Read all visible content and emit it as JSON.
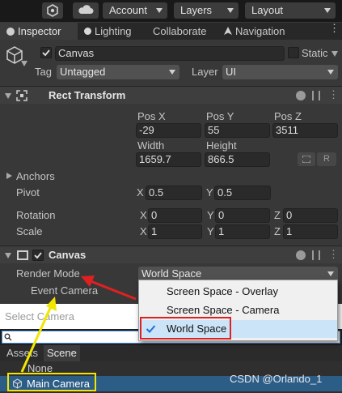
{
  "toolbar": {
    "account_label": "Account",
    "layers_label": "Layers",
    "layout_label": "Layout"
  },
  "tabs": {
    "inspector": "Inspector",
    "lighting": "Lighting",
    "collaborate": "Collaborate",
    "navigation": "Navigation"
  },
  "object": {
    "name": "Canvas",
    "static_label": "Static",
    "tag_label": "Tag",
    "tag_value": "Untagged",
    "layer_label": "Layer",
    "layer_value": "UI"
  },
  "rect_transform": {
    "title": "Rect Transform",
    "pos_x_label": "Pos X",
    "pos_y_label": "Pos Y",
    "pos_z_label": "Pos Z",
    "pos_x": "-29",
    "pos_y": "55",
    "pos_z": "3511",
    "width_label": "Width",
    "height_label": "Height",
    "width": "1659.7",
    "height": "866.5",
    "r_button": "R",
    "anchors_label": "Anchors",
    "pivot_label": "Pivot",
    "pivot_x_label": "X",
    "pivot_x": "0.5",
    "pivot_y_label": "Y",
    "pivot_y": "0.5",
    "rotation_label": "Rotation",
    "rot_x_label": "X",
    "rot_x": "0",
    "rot_y_label": "Y",
    "rot_y": "0",
    "rot_z_label": "Z",
    "rot_z": "0",
    "scale_label": "Scale",
    "scale_x_label": "X",
    "scale_x": "1",
    "scale_y_label": "Y",
    "scale_y": "1",
    "scale_z_label": "Z",
    "scale_z": "1"
  },
  "canvas_component": {
    "title": "Canvas",
    "render_mode_label": "Render Mode",
    "render_mode_value": "World Space",
    "event_camera_label": "Event Camera"
  },
  "render_mode_popup": {
    "options": [
      "Screen Space - Overlay",
      "Screen Space - Camera",
      "World Space"
    ],
    "selected_index": 2
  },
  "select_camera": {
    "title": "Select Camera",
    "tabs": [
      "Assets",
      "Scene"
    ],
    "active_tab": "Scene",
    "items": [
      "None",
      "Main Camera"
    ]
  },
  "watermark": "CSDN @Orlando_1",
  "colors": {
    "highlight_red": "#e02020",
    "highlight_yellow": "#f2e600",
    "selection_blue": "#2c5d87",
    "check_blue": "#1e6fd9"
  }
}
